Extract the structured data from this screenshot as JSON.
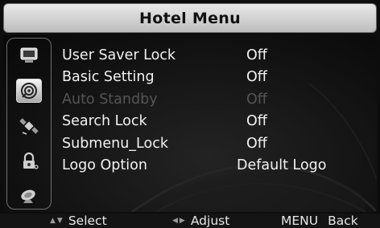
{
  "title": "Hotel Menu",
  "sidebar": {
    "icons": [
      "tv-icon",
      "settings-disc-icon",
      "satellite-icon",
      "lock-icon",
      "dish-icon"
    ],
    "selected_index": 1
  },
  "menu": {
    "items": [
      {
        "label": "User Saver Lock",
        "value": "Off",
        "enabled": true
      },
      {
        "label": "Basic Setting",
        "value": "Off",
        "enabled": true
      },
      {
        "label": "Auto Standby",
        "value": "Off",
        "enabled": false
      },
      {
        "label": "Search Lock",
        "value": "Off",
        "enabled": true
      },
      {
        "label": "Submenu_Lock",
        "value": "Off",
        "enabled": true
      },
      {
        "label": "Logo Option",
        "value": "Default Logo",
        "enabled": true
      }
    ]
  },
  "footer": {
    "select_label": "Select",
    "adjust_label": "Adjust",
    "menu_key": "MENU",
    "back_label": "Back"
  },
  "colors": {
    "text": "#f2f2f2",
    "disabled_text": "#555555",
    "title_bar": "#d6d6d6"
  }
}
